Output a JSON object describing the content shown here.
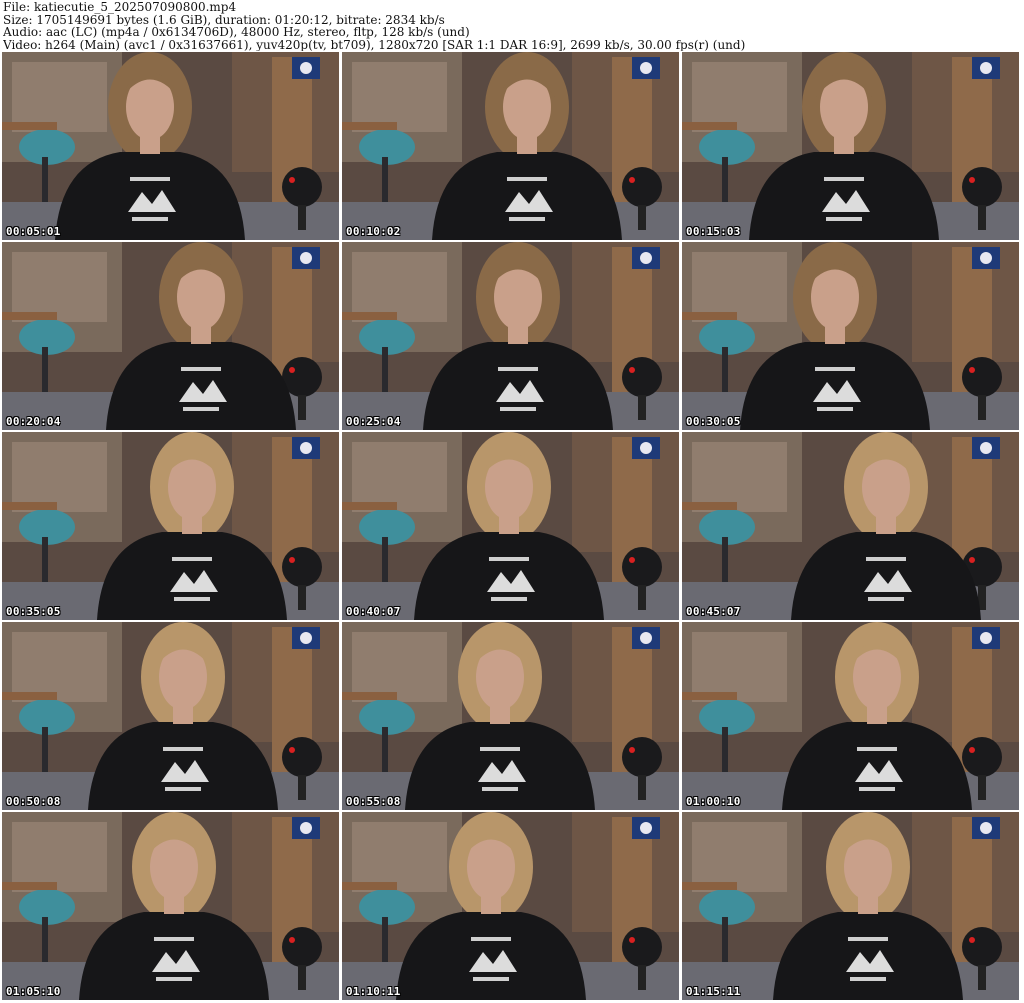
{
  "info": {
    "file_line": "File: katiecutie_5_202507090800.mp4",
    "size_line": "Size: 1705149691 bytes (1.6 GiB), duration: 01:20:12, bitrate: 2834 kb/s",
    "audio_line": "Audio: aac (LC) (mp4a / 0x6134706D), 48000 Hz, stereo, fltp, 128 kb/s (und)",
    "video_line": "Video: h264 (Main) (avc1 / 0x31637661), yuv420p(tv, bt709), 1280x720 [SAR 1:1 DAR 16:9], 2699 kb/s, 30.00 fps(r) (und)"
  },
  "thumbnails": [
    {
      "time": "00:05:01"
    },
    {
      "time": "00:10:02"
    },
    {
      "time": "00:15:03"
    },
    {
      "time": "00:20:04"
    },
    {
      "time": "00:25:04"
    },
    {
      "time": "00:30:05"
    },
    {
      "time": "00:35:05"
    },
    {
      "time": "00:40:07"
    },
    {
      "time": "00:45:07"
    },
    {
      "time": "00:50:08"
    },
    {
      "time": "00:55:08"
    },
    {
      "time": "01:00:10"
    },
    {
      "time": "01:05:10"
    },
    {
      "time": "01:10:11"
    },
    {
      "time": "01:15:11"
    }
  ],
  "colors": {
    "wall": "#5a4a42",
    "sweater": "#161618",
    "skin": "#c9a08a",
    "hair": "#8a6a48",
    "hair_light": "#b8966a",
    "chair": "#3f8f9c",
    "desk": "#8a6040",
    "flag": "#1e3a78",
    "orb_red": "#d82020",
    "floor": "#6a6a72"
  }
}
